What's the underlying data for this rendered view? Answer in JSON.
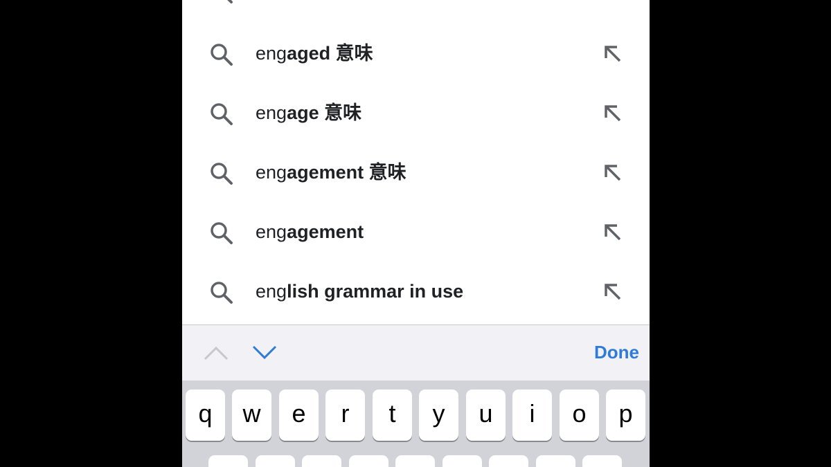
{
  "suggestions": [
    {
      "typed": "eng",
      "completion": "aged 意味"
    },
    {
      "typed": "eng",
      "completion": "age 意味"
    },
    {
      "typed": "eng",
      "completion": "agement 意味"
    },
    {
      "typed": "eng",
      "completion": "agement"
    },
    {
      "typed": "eng",
      "completion": "lish grammar in use"
    }
  ],
  "accessory": {
    "done_label": "Done"
  },
  "keyboard": {
    "row1": [
      "q",
      "w",
      "e",
      "r",
      "t",
      "y",
      "u",
      "i",
      "o",
      "p"
    ]
  },
  "colors": {
    "accent": "#2f7bd8",
    "icon": "#5f6368",
    "keyboard_bg": "#d1d3d9",
    "accessory_bg": "#f2f2f6"
  },
  "icons": {
    "search": "search-icon",
    "fill": "arrow-up-left-icon",
    "prev": "chevron-up-icon",
    "next": "chevron-down-icon"
  }
}
